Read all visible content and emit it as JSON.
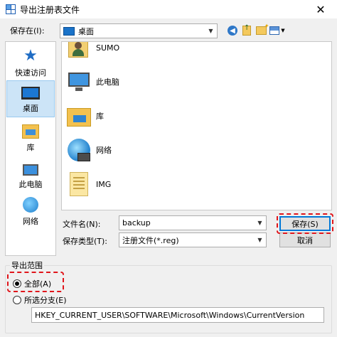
{
  "window": {
    "title": "导出注册表文件",
    "close_glyph": "✕"
  },
  "toolbar": {
    "save_in_label": "保存在(I):",
    "save_in_value": "桌面"
  },
  "places": [
    {
      "label": "快速访问",
      "icon": "quick-access-icon",
      "selected": false
    },
    {
      "label": "桌面",
      "icon": "desktop-icon",
      "selected": true
    },
    {
      "label": "库",
      "icon": "library-icon",
      "selected": false
    },
    {
      "label": "此电脑",
      "icon": "this-pc-icon",
      "selected": false
    },
    {
      "label": "网络",
      "icon": "network-icon",
      "selected": false
    }
  ],
  "files": [
    {
      "name": "SUMO",
      "icon": "user-folder-icon"
    },
    {
      "name": "此电脑",
      "icon": "this-pc-icon"
    },
    {
      "name": "库",
      "icon": "library-icon"
    },
    {
      "name": "网络",
      "icon": "network-icon"
    },
    {
      "name": "IMG",
      "icon": "document-folder-icon"
    },
    {
      "name": "",
      "icon": "folder-icon"
    }
  ],
  "form": {
    "file_name_label": "文件名(N):",
    "file_name_value": "backup",
    "file_type_label": "保存类型(T):",
    "file_type_value": "注册文件(*.reg)"
  },
  "buttons": {
    "save": "保存(S)",
    "cancel": "取消"
  },
  "export_range": {
    "title": "导出范围",
    "all_label": "全部(A)",
    "selected_label": "所选分支(E)",
    "branch_value": "HKEY_CURRENT_USER\\SOFTWARE\\Microsoft\\Windows\\CurrentVersion",
    "selected_option": "all"
  },
  "colors": {
    "highlight": "#e0151b",
    "selection": "#cce4f7",
    "accent": "#0078d7"
  }
}
